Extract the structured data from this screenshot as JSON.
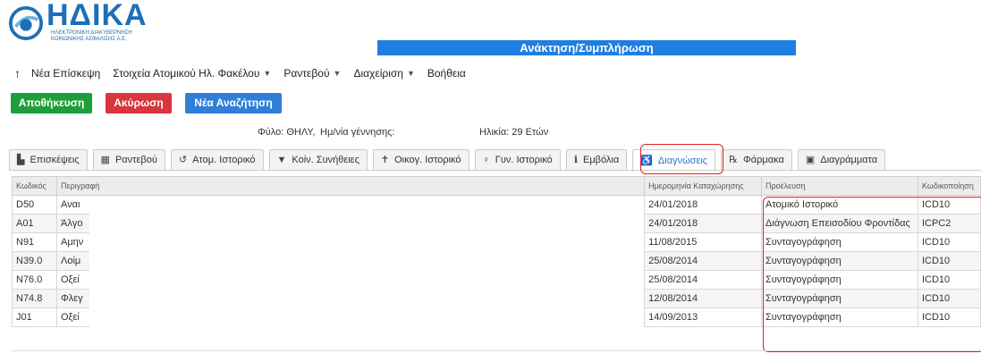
{
  "logo": {
    "word": "ΗΔΙΚΑ",
    "subtitle": "ΗΛΕΚΤΡΟΝΙΚΗ ΔΙΑΚΥΒΕΡΝΗΣΗ\nΚΟΙΝΩΝΙΚΗΣ ΑΣΦΑΛΙΣΗΣ Α.Ε."
  },
  "title_bar": "Ανάκτηση/Συμπλήρωση",
  "menu": {
    "up_icon": "arrow-up-icon",
    "items": [
      {
        "label": "Νέα Επίσκεψη",
        "dropdown": false
      },
      {
        "label": "Στοιχεία Ατομικού Ηλ. Φακέλου",
        "dropdown": true
      },
      {
        "label": "Ραντεβού",
        "dropdown": true
      },
      {
        "label": "Διαχείριση",
        "dropdown": true
      },
      {
        "label": "Βοήθεια",
        "dropdown": false
      }
    ]
  },
  "buttons": {
    "save": "Αποθήκευση",
    "cancel": "Ακύρωση",
    "new_search": "Νέα Αναζήτηση"
  },
  "patient": {
    "sex": "Φύλο: ΘΗΛΥ,",
    "birthdate_label": "Ημ/νία γέννησης:",
    "age": "Ηλικία: 29 Ετών"
  },
  "tabs": [
    {
      "label": "Επισκέψεις",
      "icon": "visits-icon",
      "glyph": "▙"
    },
    {
      "label": "Ραντεβού",
      "icon": "calendar-icon",
      "glyph": "▦"
    },
    {
      "label": "Ατομ. Ιστορικό",
      "icon": "history-icon",
      "glyph": "↺"
    },
    {
      "label": "Κοίν. Συνήθειες",
      "icon": "filter-icon",
      "glyph": "▼"
    },
    {
      "label": "Οικογ. Ιστορικό",
      "icon": "person-icon",
      "glyph": "✝"
    },
    {
      "label": "Γυν. Ιστορικό",
      "icon": "female-icon",
      "glyph": "♀"
    },
    {
      "label": "Εμβόλια",
      "icon": "info-icon",
      "glyph": "ℹ"
    },
    {
      "label": "Διαγνώσεις",
      "icon": "wheelchair-icon",
      "glyph": "♿",
      "active": true
    },
    {
      "label": "Φάρμακα",
      "icon": "pills-icon",
      "glyph": "℞"
    },
    {
      "label": "Διαγράμματα",
      "icon": "chart-icon",
      "glyph": "▣"
    }
  ],
  "table": {
    "headers": [
      "Κωδικός",
      "Περιγραφή",
      "Ημερομηνία Καταχώρησης",
      "Προέλευση",
      "Κωδικοποίηση"
    ],
    "rows": [
      {
        "code": "D50",
        "desc": "Αναι",
        "date": "24/01/2018",
        "origin": "Ατομικό Ιστορικό",
        "coding": "ICD10"
      },
      {
        "code": "A01",
        "desc": "Άλγο",
        "date": "24/01/2018",
        "origin": "Διάγνωση Επεισοδίου Φροντίδας",
        "coding": "ICPC2"
      },
      {
        "code": "N91",
        "desc": "Αμην",
        "date": "11/08/2015",
        "origin": "Συνταγογράφηση",
        "coding": "ICD10"
      },
      {
        "code": "N39.0",
        "desc": "Λοίμ",
        "date": "25/08/2014",
        "origin": "Συνταγογράφηση",
        "coding": "ICD10"
      },
      {
        "code": "N76.0",
        "desc": "Οξεί",
        "date": "25/08/2014",
        "origin": "Συνταγογράφηση",
        "coding": "ICD10"
      },
      {
        "code": "N74.8",
        "desc": "Φλεγ",
        "date": "12/08/2014",
        "origin": "Συνταγογράφηση",
        "coding": "ICD10"
      },
      {
        "code": "J01",
        "desc": "Οξεί",
        "date": "14/09/2013",
        "origin": "Συνταγογράφηση",
        "coding": "ICD10"
      }
    ]
  },
  "colors": {
    "brand": "#1d6fb8",
    "title_bar": "#1e7fe0",
    "save": "#1e9e3a",
    "cancel": "#d9363e",
    "new_search": "#2f7fd8",
    "highlight": "#e02020"
  }
}
